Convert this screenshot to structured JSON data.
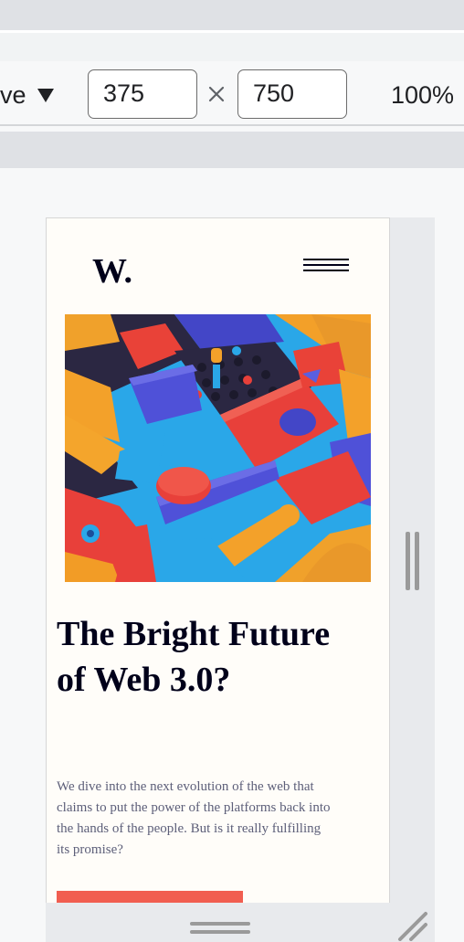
{
  "toolbar": {
    "device_label": "ve",
    "width_value": "375",
    "height_value": "750",
    "zoom": "100%"
  },
  "page": {
    "logo": "W.",
    "headline": "The Bright Future of Web 3.0?",
    "description": "We dive into the next evolution of the web that claims to put the power of the platforms back into the hands of the people. But is it really fulfilling its promise?"
  },
  "colors": {
    "background": "#fffdf9",
    "headline": "#00001a",
    "body_text": "#5d5f79",
    "cta": "#f15e50"
  }
}
